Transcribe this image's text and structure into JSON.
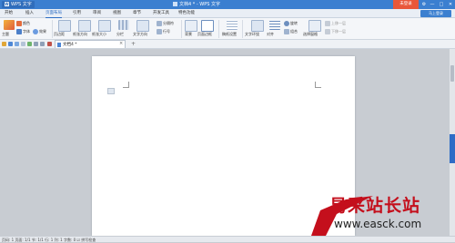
{
  "titlebar": {
    "app_name": "WPS 文字",
    "doc_title": "文档4 * - WPS 文字",
    "login_label": "未登录",
    "controls": [
      "□",
      "—",
      "□",
      "✕"
    ]
  },
  "menu": {
    "tabs": [
      "开始",
      "插入",
      "页面布局",
      "引用",
      "审阅",
      "视图",
      "章节",
      "开发工具",
      "特色功能"
    ],
    "active_index": 2,
    "right_button": "马上登录"
  },
  "ribbon": {
    "groups": [
      {
        "label": "主题"
      },
      {
        "label": "颜色"
      },
      {
        "label": "字体"
      },
      {
        "label": "效果"
      },
      {
        "label": "页边距"
      },
      {
        "label": "纸张方向"
      },
      {
        "label": "纸张大小"
      },
      {
        "label": "分栏"
      },
      {
        "label": "文字方向"
      },
      {
        "label": "分隔符"
      },
      {
        "label": "行号"
      },
      {
        "label": "背景"
      },
      {
        "label": "页面边框"
      },
      {
        "label": "稿纸设置"
      },
      {
        "label": "文字环绕"
      },
      {
        "label": "对齐"
      },
      {
        "label": "旋转"
      },
      {
        "label": "组合"
      },
      {
        "label": "选择窗格"
      },
      {
        "label": "上移一层"
      },
      {
        "label": "下移一层"
      }
    ]
  },
  "tabs": {
    "document_tab": "文档4 *",
    "close": "×",
    "new": "+"
  },
  "statusbar": {
    "text": "页码: 1  页面: 1/1  节: 1/1  行: 1  列: 1  字数: 0  ☑ 拼写检查"
  },
  "watermark": {
    "chinese": "易采站长站",
    "url": "www.easck.com"
  },
  "colors": {
    "title_blue": "#3b7fd0",
    "login_orange": "#e9573a",
    "watermark_red": "#c40f1c"
  }
}
